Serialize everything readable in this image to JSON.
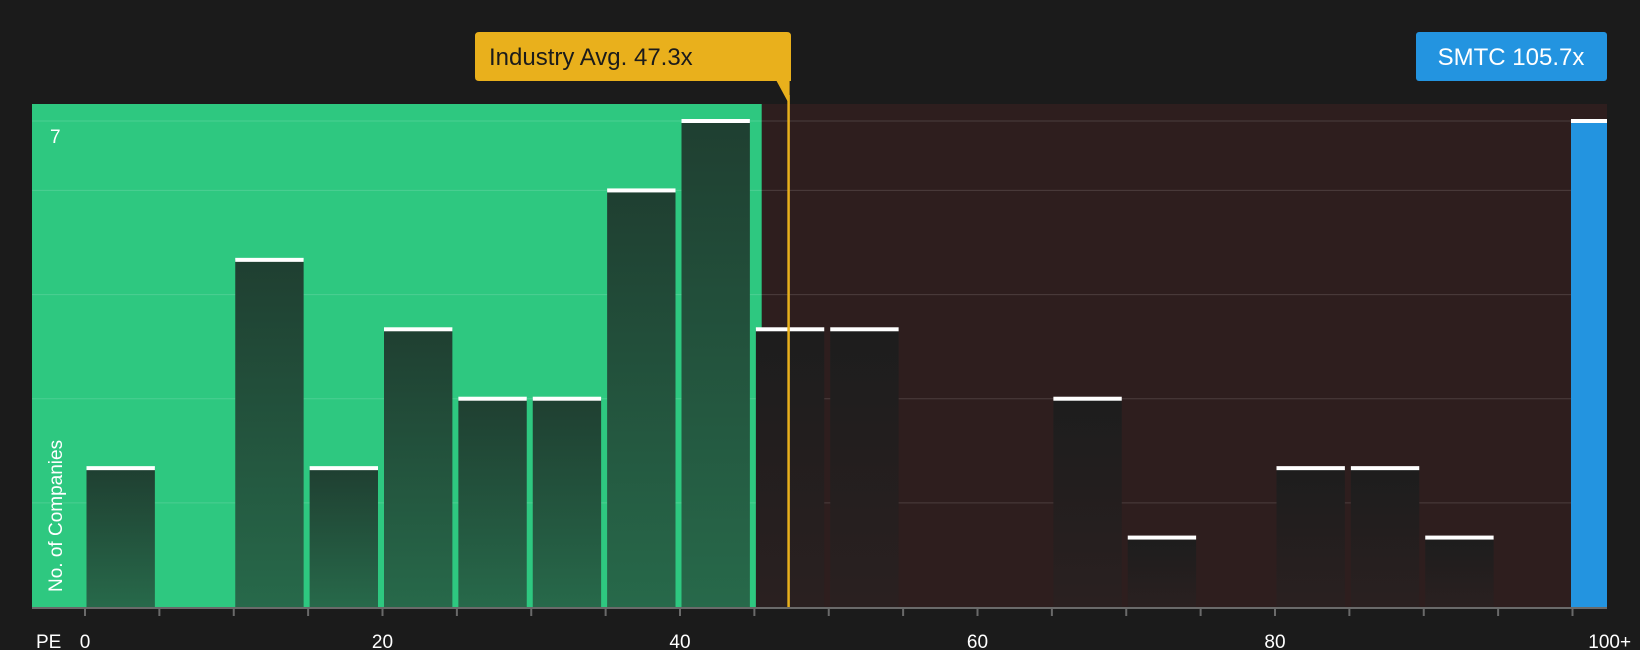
{
  "chart_data": {
    "type": "bar",
    "title": "",
    "xlabel": "PE",
    "ylabel": "No. of Companies",
    "bin_width": 5,
    "xlim": [
      -5,
      105
    ],
    "ylim": [
      0,
      7
    ],
    "x_ticks": [
      {
        "value": 0,
        "label": "0"
      },
      {
        "value": 20,
        "label": "20"
      },
      {
        "value": 40,
        "label": "40"
      },
      {
        "value": 60,
        "label": "60"
      },
      {
        "value": 80,
        "label": "80"
      },
      {
        "value": 102.5,
        "label": "100+"
      }
    ],
    "y_tick_label": {
      "value": 7,
      "label": "7"
    },
    "bins": [
      {
        "x_start": 0,
        "count": 2
      },
      {
        "x_start": 10,
        "count": 5
      },
      {
        "x_start": 15,
        "count": 2
      },
      {
        "x_start": 20,
        "count": 4
      },
      {
        "x_start": 25,
        "count": 3
      },
      {
        "x_start": 30,
        "count": 3
      },
      {
        "x_start": 35,
        "count": 6
      },
      {
        "x_start": 40,
        "count": 7
      },
      {
        "x_start": 45,
        "count": 4
      },
      {
        "x_start": 50,
        "count": 4
      },
      {
        "x_start": 65,
        "count": 3
      },
      {
        "x_start": 70,
        "count": 1
      },
      {
        "x_start": 80,
        "count": 2
      },
      {
        "x_start": 85,
        "count": 2
      },
      {
        "x_start": 90,
        "count": 1
      }
    ],
    "industry_average": {
      "label": "Industry Avg. 47.3x",
      "value": 47.3
    },
    "company": {
      "label": "SMTC 105.7x",
      "value": 105.7,
      "count": 7
    },
    "fair_range_end": 45.5,
    "colors": {
      "background": "#1b1b1b",
      "fair_region": "#2ec880",
      "high_region": "#2e1e1e",
      "bar_in_fair": "#1f4030",
      "bar_in_high": "#221e1e",
      "bar_cap": "#ffffff",
      "industry_line": "#e9b01c",
      "company_bar": "#2394e0",
      "axis": "#6a6a6a",
      "grid": "#ffffff"
    }
  }
}
